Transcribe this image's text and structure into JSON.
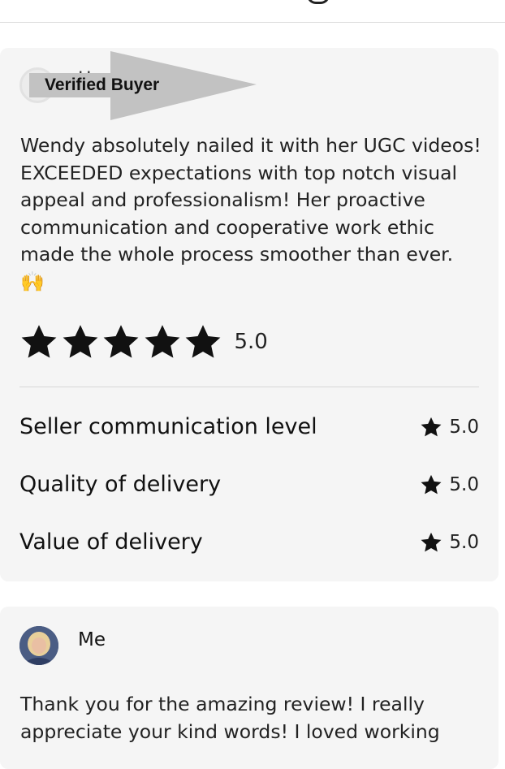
{
  "review": {
    "reviewer_name_partial": "Hole ...g",
    "verified_label": "Verified Buyer",
    "text": "Wendy absolutely nailed it with her UGC videos! EXCEEDED expectations with top notch visual appeal and professionalism! Her proactive communication and cooperative work ethic made the whole process smoother than ever.",
    "emoji": "🙌",
    "rating": 5.0,
    "rating_text": "5.0",
    "star_count": 5,
    "metrics": [
      {
        "label": "Seller communication level",
        "value": "5.0"
      },
      {
        "label": "Quality of delivery",
        "value": "5.0"
      },
      {
        "label": "Value of delivery",
        "value": "5.0"
      }
    ]
  },
  "reply": {
    "author": "Me",
    "text": "Thank you for the amazing review! I really appreciate your kind words! I loved working"
  },
  "colors": {
    "card_bg": "#f5f5f5",
    "star": "#111111",
    "overlay_gray": "#c2c2c2"
  },
  "icons": {
    "star": "star-icon",
    "avatar": "user-avatar"
  }
}
